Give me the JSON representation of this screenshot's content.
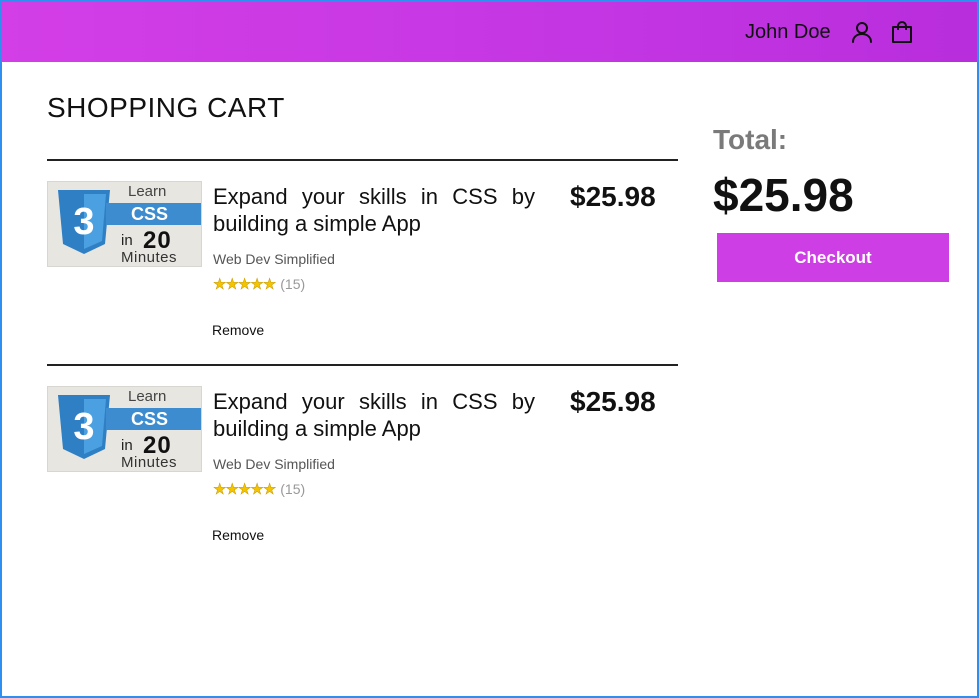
{
  "header": {
    "user_name": "John Doe",
    "user_icon": "user-icon",
    "cart_icon": "shopping-bag-icon",
    "gradient_colors": [
      "#d33ee6",
      "#b82ddc"
    ]
  },
  "cart": {
    "title": "SHOPPING CART",
    "items": [
      {
        "title": "Expand your skills in CSS by building a simple App",
        "author": "Web Dev Simplified",
        "rating_stars": 5,
        "rating_count": "(15)",
        "price": "$25.98",
        "remove_label": "Remove",
        "thumbnail": {
          "learn": "Learn",
          "css": "CSS",
          "in": "in",
          "number": "20",
          "minutes": "Minutes"
        }
      },
      {
        "title": "Expand your skills in CSS by building a simple App",
        "author": "Web Dev Simplified",
        "rating_stars": 5,
        "rating_count": "(15)",
        "price": "$25.98",
        "remove_label": "Remove",
        "thumbnail": {
          "learn": "Learn",
          "css": "CSS",
          "in": "in",
          "number": "20",
          "minutes": "Minutes"
        }
      }
    ]
  },
  "summary": {
    "total_label": "Total:",
    "total_value": "$25.98",
    "checkout_label": "Checkout",
    "accent_color": "#cd3ee5"
  }
}
